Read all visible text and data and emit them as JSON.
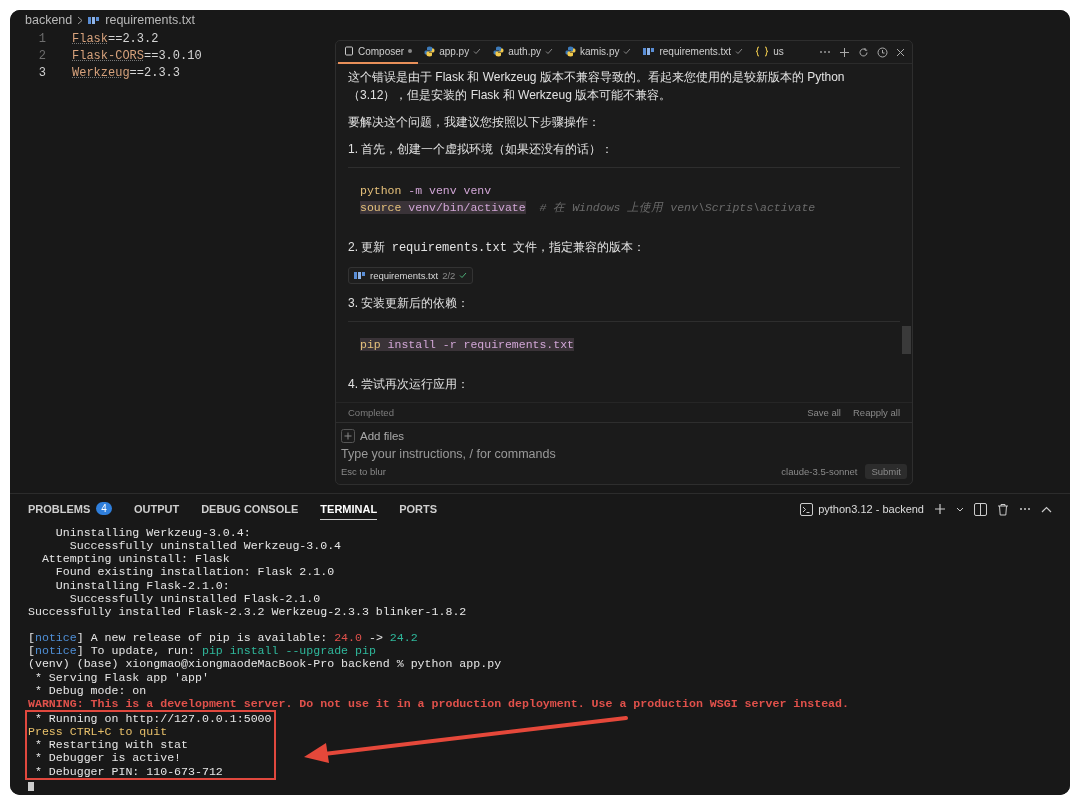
{
  "breadcrumb": {
    "folder": "backend",
    "file": "requirements.txt"
  },
  "editor": {
    "lines": [
      {
        "number": "1",
        "package": "Flask",
        "version": "==2.3.2",
        "active": false
      },
      {
        "number": "2",
        "package": "Flask-CORS",
        "version": "==3.0.10",
        "active": false
      },
      {
        "number": "3",
        "package": "Werkzeug",
        "version": "==2.3.3",
        "active": true
      }
    ]
  },
  "composer": {
    "tabs": [
      {
        "label": "Composer",
        "kind": "composer",
        "selected": true,
        "accepted": false
      },
      {
        "label": "app.py",
        "kind": "python",
        "selected": false,
        "accepted": true
      },
      {
        "label": "auth.py",
        "kind": "python",
        "selected": false,
        "accepted": true
      },
      {
        "label": "kamis.py",
        "kind": "python",
        "selected": false,
        "accepted": true
      },
      {
        "label": "requirements.txt",
        "kind": "text",
        "selected": false,
        "accepted": true
      },
      {
        "label": "us",
        "kind": "json",
        "selected": false,
        "accepted": false
      }
    ],
    "blocks": [
      {
        "kind": "para",
        "segments": [
          {
            "kind": "text",
            "text": "这个错误是由于 Flask 和 Werkzeug 版本不兼容导致的。看起来您使用的是较新版本的 Python（3.12），但是安装的 Flask 和 Werkzeug 版本可能不兼容。"
          }
        ]
      },
      {
        "kind": "para",
        "segments": [
          {
            "kind": "text",
            "text": "要解决这个问题，我建议您按照以下步骤操作："
          }
        ]
      },
      {
        "kind": "para",
        "segments": [
          {
            "kind": "text",
            "text": "1. 首先，创建一个虚拟环境（如果还没有的话）："
          }
        ]
      },
      {
        "kind": "code",
        "lines": [
          [
            {
              "kind": "cmd",
              "text": "python"
            },
            {
              "kind": "arg",
              "text": " -m venv venv"
            }
          ],
          [
            {
              "kind": "cmd-hl",
              "text": "source"
            },
            {
              "kind": "arg-hl",
              "text": " venv/bin/activate"
            },
            {
              "kind": "comment",
              "text": "  # 在 Windows 上使用 venv\\Scripts\\activate"
            }
          ]
        ]
      },
      {
        "kind": "para",
        "segments": [
          {
            "kind": "text",
            "text": "2. 更新 "
          },
          {
            "kind": "code",
            "text": "requirements.txt"
          },
          {
            "kind": "text",
            "text": " 文件，指定兼容的版本："
          }
        ]
      },
      {
        "kind": "chip",
        "file": "requirements.txt",
        "count": "2/2"
      },
      {
        "kind": "para",
        "segments": [
          {
            "kind": "text",
            "text": "3. 安装更新后的依赖："
          }
        ]
      },
      {
        "kind": "code",
        "lines": [
          [
            {
              "kind": "cmd-hl",
              "text": "pip"
            },
            {
              "kind": "arg-hl",
              "text": " install -r requirements.txt"
            }
          ]
        ]
      },
      {
        "kind": "para",
        "segments": [
          {
            "kind": "text",
            "text": "4. 尝试再次运行应用："
          }
        ]
      }
    ],
    "status": "Completed",
    "actions": [
      "Save all",
      "Reapply all"
    ],
    "add_files": "Add files",
    "placeholder": "Type your instructions, / for commands",
    "hint": "Esc to blur",
    "model": "claude-3.5-sonnet",
    "submit": {
      "label": "Submit",
      "disabled": true
    }
  },
  "panel": {
    "tabs": [
      {
        "label": "PROBLEMS",
        "badge": "4",
        "selected": false
      },
      {
        "label": "OUTPUT",
        "selected": false
      },
      {
        "label": "DEBUG CONSOLE",
        "selected": false
      },
      {
        "label": "TERMINAL",
        "selected": true
      },
      {
        "label": "PORTS",
        "selected": false
      }
    ],
    "terminal_name": "python3.12 - backend"
  },
  "terminal": {
    "lines": [
      [
        {
          "kind": "plain",
          "text": "    Uninstalling Werkzeug-3.0.4:"
        }
      ],
      [
        {
          "kind": "plain",
          "text": "      Successfully uninstalled Werkzeug-3.0.4"
        }
      ],
      [
        {
          "kind": "plain",
          "text": "  Attempting uninstall: Flask"
        }
      ],
      [
        {
          "kind": "plain",
          "text": "    Found existing installation: Flask 2.1.0"
        }
      ],
      [
        {
          "kind": "plain",
          "text": "    Uninstalling Flask-2.1.0:"
        }
      ],
      [
        {
          "kind": "plain",
          "text": "      Successfully uninstalled Flask-2.1.0"
        }
      ],
      [
        {
          "kind": "plain",
          "text": "Successfully installed Flask-2.3.2 Werkzeug-2.3.3 blinker-1.8.2"
        }
      ],
      [
        {
          "kind": "gap"
        },
        {
          "kind": "plain",
          "text": "["
        },
        {
          "kind": "notice",
          "text": "notice"
        },
        {
          "kind": "plain",
          "text": "] A new release of pip is available: "
        },
        {
          "kind": "old",
          "text": "24.0"
        },
        {
          "kind": "plain",
          "text": " -> "
        },
        {
          "kind": "new",
          "text": "24.2"
        }
      ],
      [
        {
          "kind": "plain",
          "text": "["
        },
        {
          "kind": "notice",
          "text": "notice"
        },
        {
          "kind": "plain",
          "text": "] To update, run: "
        },
        {
          "kind": "new",
          "text": "pip install --upgrade pip"
        }
      ],
      [
        {
          "kind": "plain",
          "text": "(venv) (base) xiongmao@xiongmaodeMacBook-Pro backend % python app.py"
        }
      ],
      [
        {
          "kind": "plain",
          "text": " * Serving Flask app 'app'"
        }
      ],
      [
        {
          "kind": "plain",
          "text": " * Debug mode: on"
        }
      ],
      [
        {
          "kind": "warning",
          "text": "WARNING: This is a development server. Do not use it in a production deployment. Use a production WSGI server instead."
        }
      ]
    ],
    "highlighted_lines": [
      [
        {
          "kind": "plain",
          "text": " * Running on http://127.0.0.1:5000"
        }
      ],
      [
        {
          "kind": "yellow",
          "text": "Press CTRL+C to quit"
        }
      ],
      [
        {
          "kind": "plain",
          "text": " * Restarting with stat"
        }
      ],
      [
        {
          "kind": "plain",
          "text": " * Debugger is active!"
        }
      ],
      [
        {
          "kind": "plain",
          "text": " * Debugger PIN: 110-673-712"
        }
      ]
    ]
  }
}
